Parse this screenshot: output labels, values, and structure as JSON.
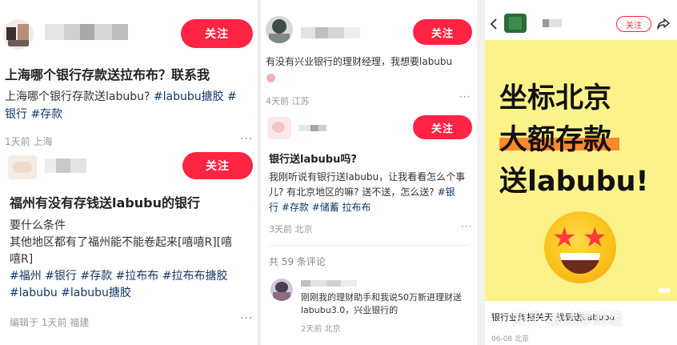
{
  "posts": {
    "p1": {
      "follow": "关注",
      "title": "上海哪个银行存款送拉布布？联系我",
      "body_line1_text": "上海哪个银行存款送labubu? ",
      "body_line1_tag1": "#labubu搪胶",
      "body_line1_tag2": " #",
      "body_line2_tag1": "银行",
      "body_line2_tag2": " #存款",
      "meta": "1天前 上海",
      "more": "···"
    },
    "p2": {
      "follow": "关注",
      "title": "福州有没有存钱送labubu的银行",
      "line1": "要什么条件",
      "line2": "其他地区都有了福州能不能卷起来[嘻嘻R][嘻",
      "line3": "嘻R]",
      "tags_line1": "#福州 #银行 #存款 #拉布布 #拉布布搪胶",
      "tags_line2": "#labubu #labubu搪胶",
      "meta": "编辑于 1天前 福建",
      "more": "···"
    },
    "p3": {
      "follow": "关注",
      "body": "有没有兴业银行的理财经理，我想要labubu",
      "meta": "4天前 江苏",
      "more": "···"
    },
    "p4": {
      "follow": "关注",
      "title": "银行送labubu吗?",
      "line1": "我刚听说有银行送labubu，让我看看怎么个事",
      "line2_text": "儿? 有北京地区的嘛? 送不送，怎么送? ",
      "line2_tag": "#银",
      "line3_tags": "行 #存款 #储蓄 拉布布",
      "meta": "3天前 北京",
      "more": "···",
      "comments_count": "共 59 条评论",
      "comment_line1": "刚刚我的理财助手和我说50万新进理财送",
      "comment_line2": "labubu3.0，兴业银行的",
      "comment_meta": "2天前 北京"
    },
    "p5": {
      "follow": "关注",
      "back_icon": "chevron-left-icon",
      "share_icon": "share-icon",
      "card_line1": "坐标北京",
      "card_line2": "大额存款",
      "card_line3": "送labubu!",
      "caption": "银行业周报关天 找到送Labubu",
      "meta": "06-08 北京"
    }
  },
  "watermark": "知乎 @达摩财经",
  "colors": {
    "follow_red": "#ff2442",
    "tag_blue": "#13386c",
    "card_yellow": "#fbf28a",
    "highlight_orange": "#ff8a2e"
  }
}
